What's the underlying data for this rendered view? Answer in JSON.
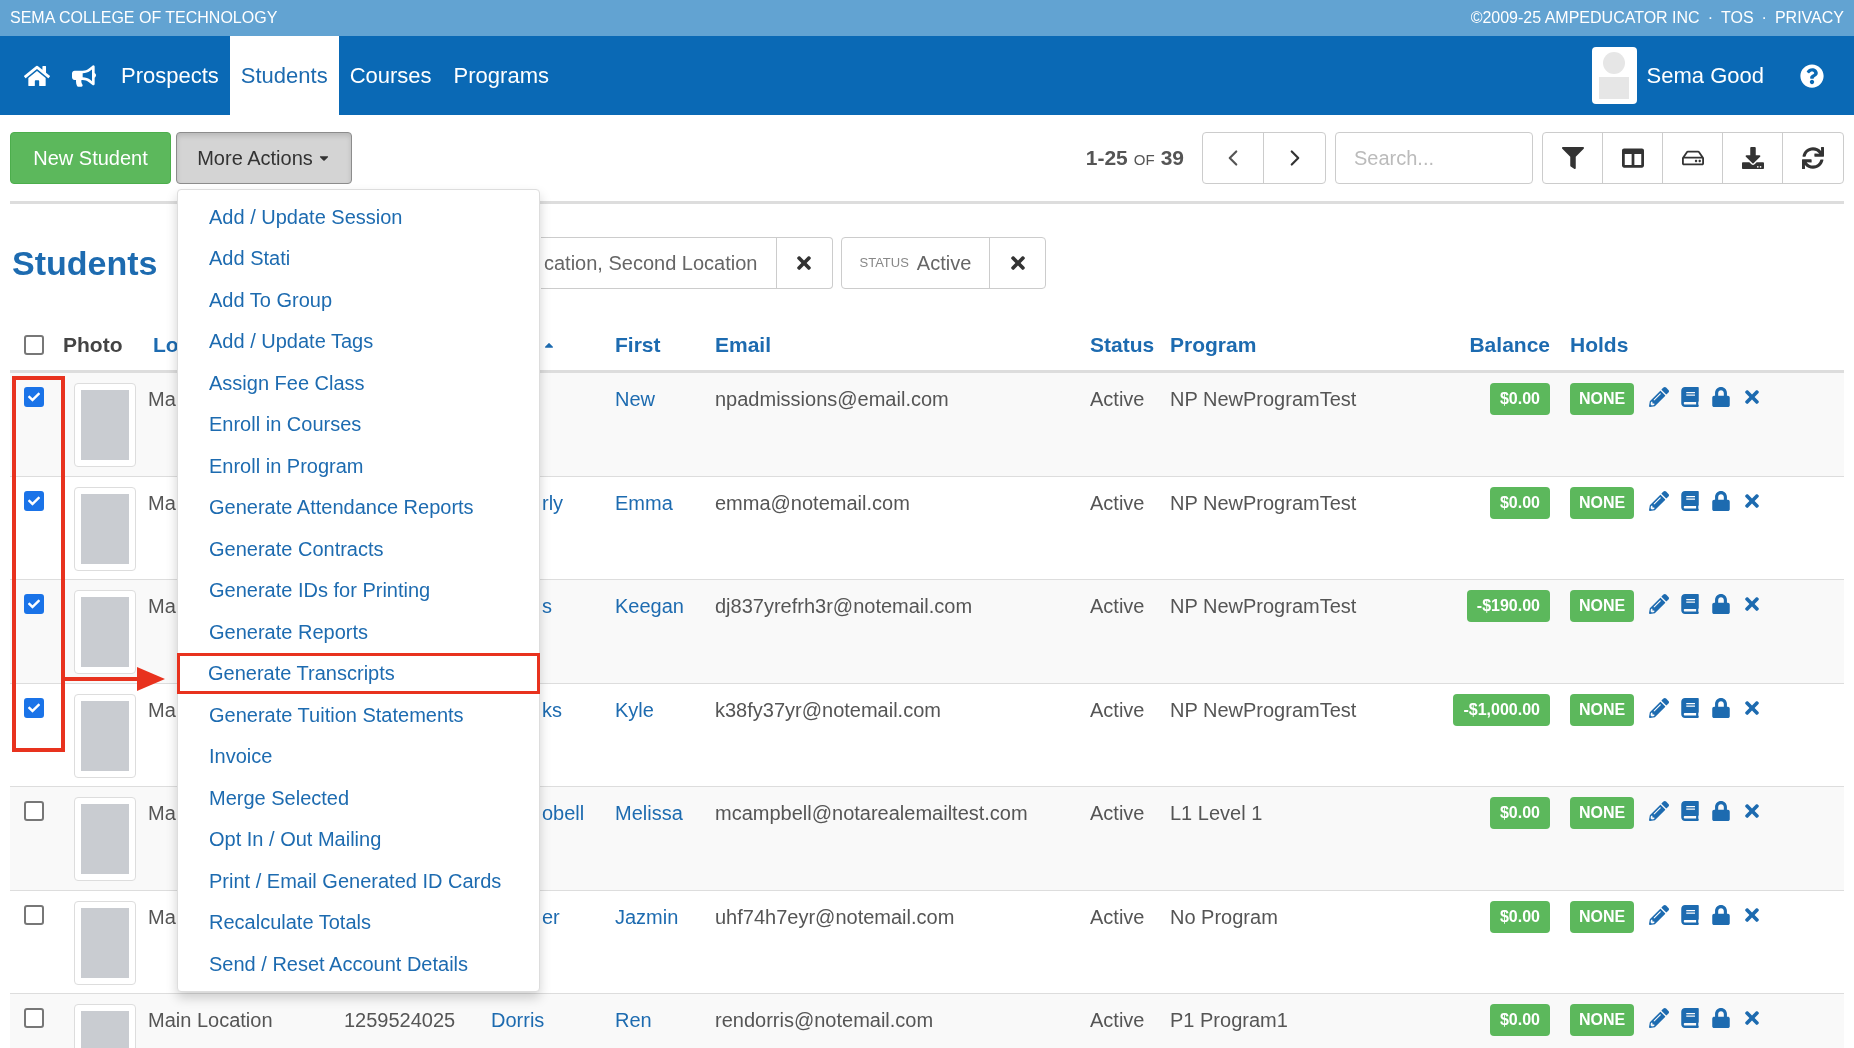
{
  "top_bar": {
    "school": "SEMA COLLEGE OF TECHNOLOGY",
    "links": [
      "©2009-25 AMPEDUCATOR INC",
      "TOS",
      "PRIVACY"
    ],
    "separator": "·"
  },
  "nav": {
    "items": [
      {
        "label": "Prospects",
        "selected": false
      },
      {
        "label": "Students",
        "selected": true
      },
      {
        "label": "Courses",
        "selected": false
      },
      {
        "label": "Programs",
        "selected": false
      }
    ],
    "user": "Sema Good"
  },
  "toolbar": {
    "new_button": "New Student",
    "more_button": "More Actions",
    "range": "1-25",
    "of": "OF",
    "total": "39",
    "search": {
      "placeholder": "Search..."
    }
  },
  "menu": {
    "items": [
      {
        "label": "Add / Update Session",
        "highlighted": false
      },
      {
        "label": "Add Stati",
        "highlighted": false
      },
      {
        "label": "Add To Group",
        "highlighted": false
      },
      {
        "label": "Add / Update Tags",
        "highlighted": false
      },
      {
        "label": "Assign Fee Class",
        "highlighted": false
      },
      {
        "label": "Enroll in Courses",
        "highlighted": false
      },
      {
        "label": "Enroll in Program",
        "highlighted": false
      },
      {
        "label": "Generate Attendance Reports",
        "highlighted": false
      },
      {
        "label": "Generate Contracts",
        "highlighted": false
      },
      {
        "label": "Generate IDs for Printing",
        "highlighted": false
      },
      {
        "label": "Generate Reports",
        "highlighted": false
      },
      {
        "label": "Generate Transcripts",
        "highlighted": true
      },
      {
        "label": "Generate Tuition Statements",
        "highlighted": false
      },
      {
        "label": "Invoice",
        "highlighted": false
      },
      {
        "label": "Merge Selected",
        "highlighted": false
      },
      {
        "label": "Opt In / Out Mailing",
        "highlighted": false
      },
      {
        "label": "Print / Email Generated ID Cards",
        "highlighted": false
      },
      {
        "label": "Recalculate Totals",
        "highlighted": false
      },
      {
        "label": "Send / Reset Account Details",
        "highlighted": false
      }
    ]
  },
  "page_title": "Students",
  "filters": [
    {
      "value": "cation, Second Location"
    },
    {
      "label": "STATUS",
      "value": "Active"
    }
  ],
  "table": {
    "select_all": {
      "checked": false
    },
    "columns": [
      {
        "label": "Photo",
        "sortable": false
      },
      {
        "label": "Lo",
        "sortable": true
      },
      {
        "label": "First",
        "sortable": true
      },
      {
        "label": "Email",
        "sortable": true
      },
      {
        "label": "Status",
        "sortable": true
      },
      {
        "label": "Program",
        "sortable": true
      },
      {
        "label": "Balance",
        "sortable": true
      },
      {
        "label": "Holds",
        "sortable": true
      }
    ],
    "rows": [
      {
        "selected": true,
        "location": "Ma",
        "first": "New",
        "email": "npadmissions@email.com",
        "status": "Active",
        "program": "NP NewProgramTest",
        "balance": "$0.00",
        "holds": "NONE"
      },
      {
        "selected": true,
        "location": "Ma",
        "last": "rly",
        "first": "Emma",
        "email": "emma@notemail.com",
        "status": "Active",
        "program": "NP NewProgramTest",
        "balance": "$0.00",
        "holds": "NONE"
      },
      {
        "selected": true,
        "location": "Ma",
        "last": "s",
        "first": "Keegan",
        "email": "dj837yrefrh3r@notemail.com",
        "status": "Active",
        "program": "NP NewProgramTest",
        "balance": "-$190.00",
        "holds": "NONE"
      },
      {
        "selected": true,
        "location": "Ma",
        "last": "ks",
        "first": "Kyle",
        "email": "k38fy37yr@notemail.com",
        "status": "Active",
        "program": "NP NewProgramTest",
        "balance": "-$1,000.00",
        "holds": "NONE"
      },
      {
        "selected": false,
        "location": "Ma",
        "last": "obell",
        "first": "Melissa",
        "email": "mcampbell@notarealemailtest.com",
        "status": "Active",
        "program": "L1 Level 1",
        "balance": "$0.00",
        "holds": "NONE"
      },
      {
        "selected": false,
        "location": "Ma",
        "last": "er",
        "first": "Jazmin",
        "email": "uhf74h7eyr@notemail.com",
        "status": "Active",
        "program": "No Program",
        "balance": "$0.00",
        "holds": "NONE"
      },
      {
        "selected": false,
        "location": "Main Location",
        "id": "1259524025",
        "last": "Dorris",
        "first": "Ren",
        "email": "rendorris@notemail.com",
        "status": "Active",
        "program": "P1 Program1",
        "balance": "$0.00",
        "holds": "NONE"
      }
    ]
  }
}
